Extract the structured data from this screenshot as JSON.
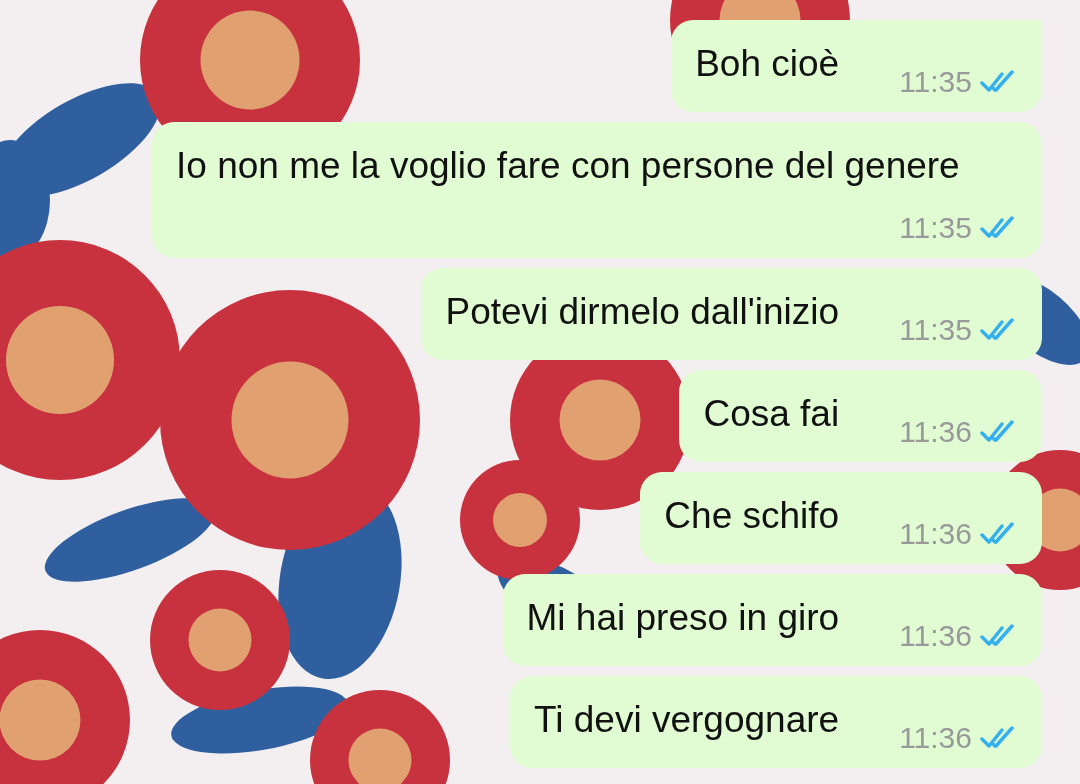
{
  "messages": [
    {
      "text": "Boh cioè",
      "time": "11:35",
      "read": true,
      "tail": true
    },
    {
      "text": "Io non me la voglio fare con persone del genere",
      "time": "11:35",
      "read": true,
      "tail": false
    },
    {
      "text": "Potevi dirmelo dall'inizio",
      "time": "11:35",
      "read": true,
      "tail": false
    },
    {
      "text": "Cosa fai",
      "time": "11:36",
      "read": true,
      "tail": false
    },
    {
      "text": "Che schifo",
      "time": "11:36",
      "read": true,
      "tail": false
    },
    {
      "text": "Mi hai preso in giro",
      "time": "11:36",
      "read": true,
      "tail": false
    },
    {
      "text": "Ti devi vergognare",
      "time": "11:36",
      "read": true,
      "tail": false
    }
  ]
}
